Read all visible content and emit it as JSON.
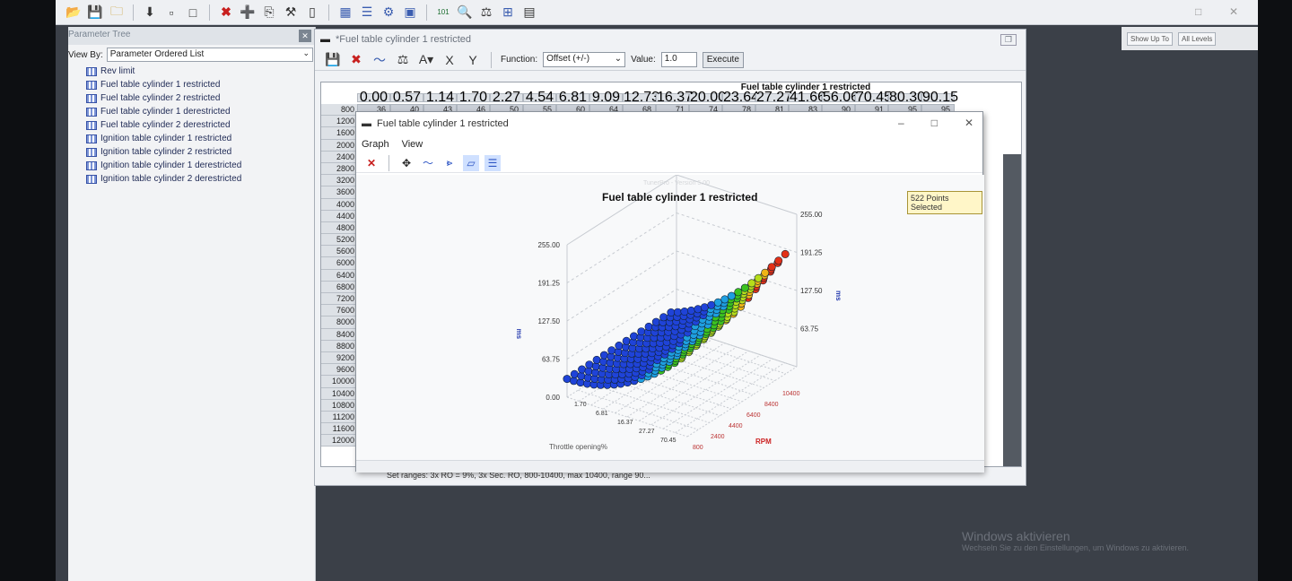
{
  "window": {
    "title": "Fuel table cylinder 1 restricted"
  },
  "main_toolbar": {
    "icons": [
      "folder-open-icon",
      "save-icon",
      "save-all-icon",
      "document-icon",
      "new-icon",
      "delete-icon",
      "add-icon",
      "copy-icon",
      "tool-icon",
      "blank-icon",
      "grid-icon",
      "list-icon",
      "settings-icon",
      "monitor-icon",
      "counter-icon",
      "search-icon",
      "scale-icon",
      "tree-icon",
      "calculator-icon"
    ],
    "counter_label": "101\n011"
  },
  "right_strip": {
    "show_up_to": "Show Up To",
    "all_levels": "All Levels"
  },
  "param_tree": {
    "title": "Parameter Tree",
    "view_by_label": "View By:",
    "view_by_value": "Parameter Ordered List",
    "items": [
      {
        "label": "Rev limit"
      },
      {
        "label": "Fuel table cylinder 1 restricted"
      },
      {
        "label": "Fuel table cylinder 2 restricted"
      },
      {
        "label": "Fuel table cylinder 1 derestricted"
      },
      {
        "label": "Fuel table cylinder 2 derestricted"
      },
      {
        "label": "Ignition table cylinder 1 restricted"
      },
      {
        "label": "Ignition table cylinder 2 restricted"
      },
      {
        "label": "Ignition table cylinder 1 derestricted"
      },
      {
        "label": "Ignition table cylinder 2 derestricted"
      }
    ]
  },
  "table_window": {
    "title": "*Fuel table cylinder 1 restricted",
    "function_label": "Function:",
    "function_value": "Offset (+/-)",
    "value_label": "Value:",
    "value": "1.0",
    "execute_label": "Execute",
    "caption": "Fuel table cylinder 1 restricted",
    "x_axis": [
      "0.00",
      "0.57",
      "1.14",
      "1.70",
      "2.27",
      "4.54",
      "6.81",
      "9.09",
      "12.73",
      "16.37",
      "20.00",
      "23.64",
      "27.27",
      "41.66",
      "56.06",
      "70.45",
      "80.30",
      "90.15"
    ],
    "rpm": [
      "800",
      "1200",
      "1600",
      "2000",
      "2400",
      "2800",
      "3200",
      "3600",
      "4000",
      "4400",
      "4800",
      "5200",
      "5600",
      "6000",
      "6400",
      "6800",
      "7200",
      "7600",
      "8000",
      "8400",
      "8800",
      "9200",
      "9600",
      "10000",
      "10400",
      "10800",
      "11200",
      "11600",
      "12000"
    ],
    "first_row_values": [
      "36",
      "40",
      "43",
      "46",
      "50",
      "55",
      "60",
      "64",
      "68",
      "71",
      "74",
      "78",
      "81",
      "83",
      "90",
      "91",
      "95",
      "95"
    ],
    "footer_text": "Set ranges: 3x RO = 9%, 3x Sec. RO, 800-10400, max 10400, range 90..."
  },
  "graph_window": {
    "title": "Fuel table cylinder 1 restricted",
    "menu": [
      "Graph",
      "View"
    ],
    "watermark": "TunerPro - Version 5.00",
    "points_selected": "522 Points Selected",
    "chart_data": {
      "type": "surface",
      "title": "Fuel table cylinder 1 restricted",
      "zlabel": "ms",
      "z_ticks": [
        "0.00",
        "63.75",
        "127.50",
        "191.25",
        "255.00"
      ],
      "x_ticks": [
        "1.70",
        "6.81",
        "16.37",
        "27.27",
        "70.45"
      ],
      "xlabel": "Throttle opening%",
      "y_ticks": [
        "800",
        "2400",
        "4400",
        "6400",
        "8400",
        "10400"
      ],
      "ylabel": "RPM",
      "right_z_ticks": [
        "63.75",
        "127.50",
        "191.25",
        "255.00"
      ]
    }
  },
  "activation": {
    "title": "Windows aktivieren",
    "subtitle": "Wechseln Sie zu den Einstellungen, um Windows zu aktivieren."
  }
}
